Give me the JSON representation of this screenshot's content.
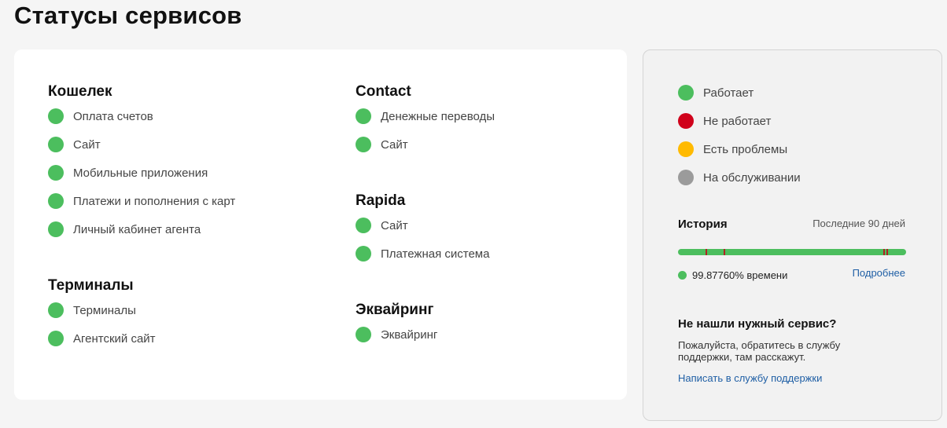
{
  "page_title": "Статусы сервисов",
  "colors": {
    "working": "#4cbe5e",
    "not_working": "#d0021b",
    "problems": "#ffba00",
    "maintenance": "#9b9b9b",
    "incident_tick": "#b02323"
  },
  "groups": [
    {
      "title": "Кошелек",
      "services": [
        "Оплата счетов",
        "Сайт",
        "Мобильные приложения",
        "Платежи и пополнения с карт",
        "Личный кабинет агента"
      ]
    },
    {
      "title": "Терминалы",
      "services": [
        "Терминалы",
        "Агентский сайт"
      ]
    },
    {
      "title": "Contact",
      "services": [
        "Денежные переводы",
        "Сайт"
      ]
    },
    {
      "title": "Rapida",
      "services": [
        "Сайт",
        "Платежная система"
      ]
    },
    {
      "title": "Эквайринг",
      "services": [
        "Эквайринг"
      ]
    }
  ],
  "legend": [
    {
      "label": "Работает",
      "status": "working"
    },
    {
      "label": "Не работает",
      "status": "not_working"
    },
    {
      "label": "Есть проблемы",
      "status": "problems"
    },
    {
      "label": "На обслуживании",
      "status": "maintenance"
    }
  ],
  "history": {
    "title": "История",
    "period": "Последние 90 дней",
    "uptime_text": "99.87760% времени",
    "details_label": "Подробнее"
  },
  "support": {
    "title": "Не нашли нужный сервис?",
    "text": "Пожалуйста, обратитесь в службу поддержки, там расскажут.",
    "link_label": "Написать в службу поддержки"
  }
}
